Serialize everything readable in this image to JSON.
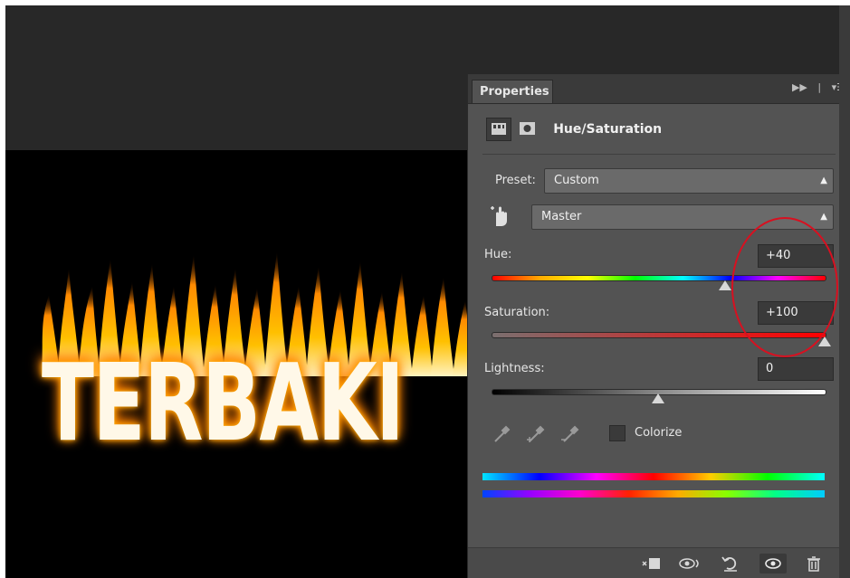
{
  "canvas": {
    "text": "TERBAKI"
  },
  "panel": {
    "tab_label": "Properties",
    "adjustment_title": "Hue/Saturation",
    "preset": {
      "label": "Preset:",
      "value": "Custom"
    },
    "channel": {
      "value": "Master"
    },
    "hue": {
      "label": "Hue:",
      "value": "+40",
      "slider_position": 0.73
    },
    "saturation": {
      "label": "Saturation:",
      "value": "+100",
      "slider_position": 1.0
    },
    "lightness": {
      "label": "Lightness:",
      "value": "0",
      "slider_position": 0.5
    },
    "colorize_label": "Colorize",
    "colorize_checked": false
  },
  "icons": {
    "panel_menu": [
      "collapse-icon",
      "panel-menu-icon"
    ],
    "tools": [
      "eyedropper-icon",
      "eyedropper-plus-icon",
      "eyedropper-minus-icon"
    ],
    "footer": [
      "clip-to-layer-icon",
      "view-previous-state-icon",
      "reset-icon",
      "visibility-icon",
      "trash-icon"
    ]
  },
  "colors": {
    "panel_bg": "#535353",
    "annotation": "#d81020"
  }
}
